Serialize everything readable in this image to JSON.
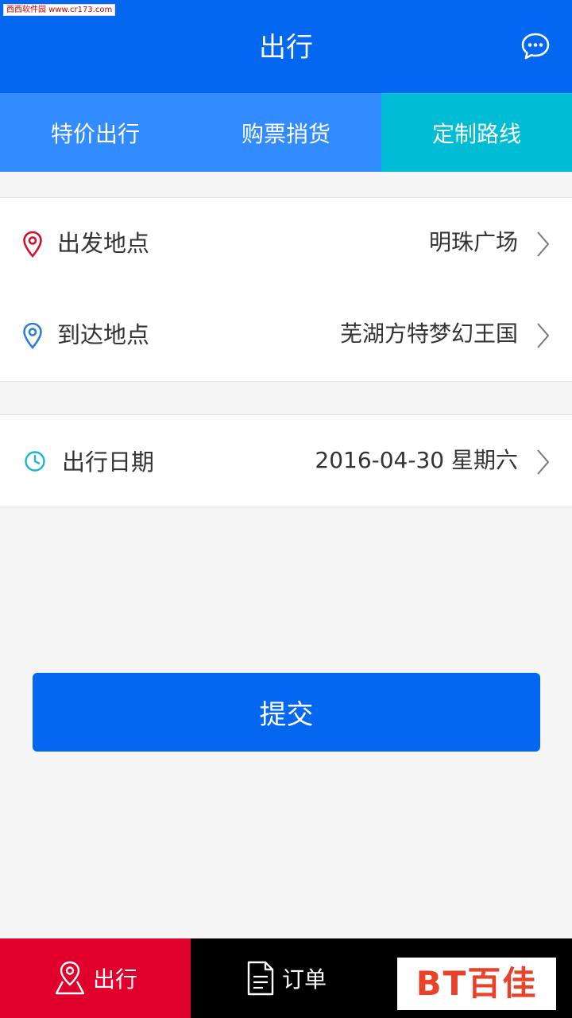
{
  "watermark": {
    "text": "西西软件园 www.cr173.com"
  },
  "header": {
    "title": "出行"
  },
  "tabs": [
    {
      "label": "特价出行",
      "active": false
    },
    {
      "label": "购票捎货",
      "active": false
    },
    {
      "label": "定制路线",
      "active": true
    }
  ],
  "form": {
    "departure": {
      "label": "出发地点",
      "value": "明珠广场"
    },
    "arrival": {
      "label": "到达地点",
      "value": "芜湖方特梦幻王国"
    },
    "date": {
      "label": "出行日期",
      "value": "2016-04-30 星期六"
    }
  },
  "submit": {
    "label": "提交"
  },
  "tabbar": [
    {
      "label": "出行",
      "active": true,
      "icon": "map-pin-icon"
    },
    {
      "label": "订单",
      "active": false,
      "icon": "document-icon"
    }
  ],
  "brand": {
    "text": "BT百佳"
  },
  "colors": {
    "primary": "#0368ef",
    "tab_bg": "#338cff",
    "tab_active": "#00bcd4",
    "departure_icon": "#d0102a",
    "arrival_icon": "#2b7fd8",
    "date_icon": "#1cb5d6",
    "tabbar_active": "#e0002b"
  }
}
